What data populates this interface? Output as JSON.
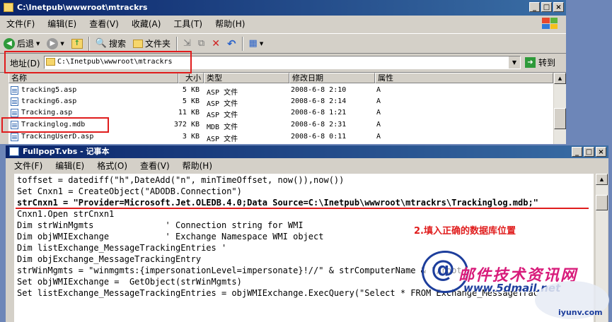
{
  "explorer": {
    "title": "C:\\Inetpub\\wwwroot\\mtrackrs",
    "menu": [
      "文件(F)",
      "编辑(E)",
      "查看(V)",
      "收藏(A)",
      "工具(T)",
      "帮助(H)"
    ],
    "toolbar": {
      "back": "后退",
      "search": "搜索",
      "folders": "文件夹"
    },
    "address": {
      "label": "地址(D)",
      "value": "C:\\Inetpub\\wwwroot\\mtrackrs",
      "go": "转到"
    },
    "columns": {
      "name": "名称",
      "size": "大小",
      "type": "类型",
      "modified": "修改日期",
      "attributes": "属性"
    },
    "files": [
      {
        "name": "tracking5.asp",
        "size": "5 KB",
        "type": "ASP 文件",
        "modified": "2008-6-8 2:10",
        "attr": "A"
      },
      {
        "name": "tracking6.asp",
        "size": "5 KB",
        "type": "ASP 文件",
        "modified": "2008-6-8 2:14",
        "attr": "A"
      },
      {
        "name": "Tracking.asp",
        "size": "11 KB",
        "type": "ASP 文件",
        "modified": "2008-6-8 1:21",
        "attr": "A"
      },
      {
        "name": "Trackinglog.mdb",
        "size": "372 KB",
        "type": "MDB 文件",
        "modified": "2008-6-8 2:31",
        "attr": "A"
      },
      {
        "name": "TrackingUserD.asp",
        "size": "3 KB",
        "type": "ASP 文件",
        "modified": "2008-6-8 0:11",
        "attr": "A"
      }
    ]
  },
  "notepad": {
    "title": "FullpopT.vbs - 记事本",
    "menu": [
      "文件(F)",
      "编辑(E)",
      "格式(O)",
      "查看(V)",
      "帮助(H)"
    ],
    "lines": [
      "toffset = datediff(\"h\",DateAdd(\"n\", minTimeOffset, now()),now())",
      "Set Cnxn1 = CreateObject(\"ADODB.Connection\")",
      "strCnxn1 = \"Provider=Microsoft.Jet.OLEDB.4.0;Data Source=C:\\Inetpub\\wwwroot\\mtrackrs\\Trackinglog.mdb;\"",
      "Cnxn1.Open strCnxn1",
      "Dim strWinMgmts              ' Connection string for WMI",
      "Dim objWMIExchange           ' Exchange Namespace WMI object",
      "Dim listExchange_MessageTrackingEntries '",
      "Dim objExchange_MessageTrackingEntry",
      "strWinMgmts = \"winmgmts:{impersonationLevel=impersonate}!//\" & strComputerName & \"/root/",
      "Set objWMIExchange =  GetObject(strWinMgmts)",
      "Set listExchange_MessageTrackingEntries = objWMIExchange.ExecQuery(\"Select * FROM Exchange_MessageTrac"
    ]
  },
  "annotation": "2.填入正确的数据库位置",
  "watermark": {
    "cn": "邮件技术资讯网",
    "url": "www.5dmail.net",
    "corner": "iyunv.com"
  },
  "colors": {
    "accent_red": "#e01c1c",
    "titlebar": "#0a246a",
    "watermark_pink": "#d81b7a"
  }
}
